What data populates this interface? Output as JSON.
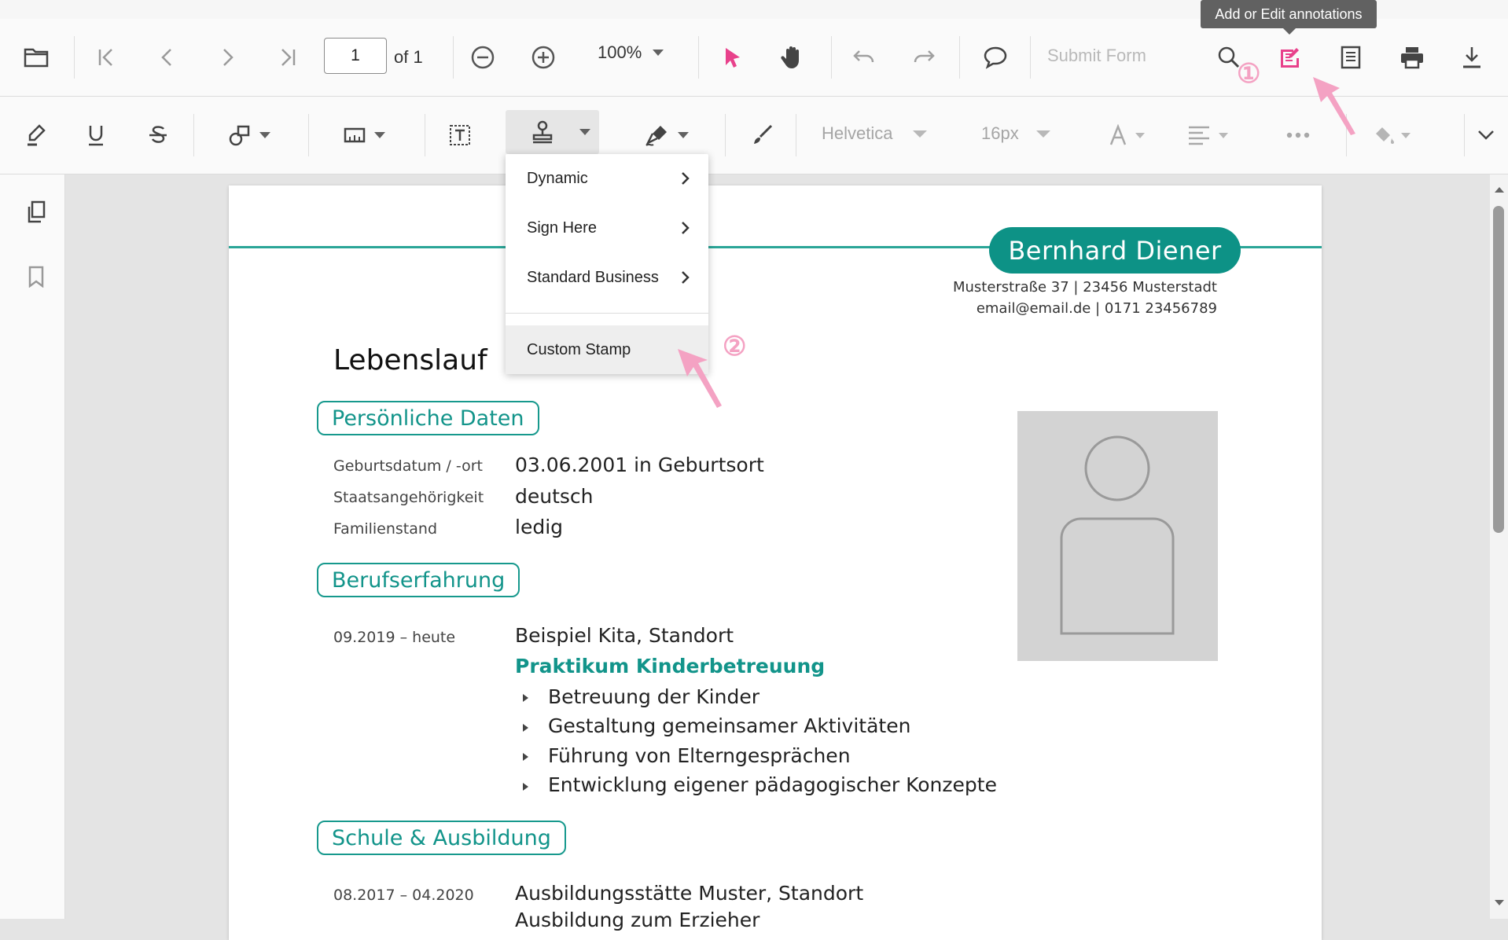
{
  "toolbar": {
    "page_number": "1",
    "page_of": "of 1",
    "zoom": "100%",
    "submit_form": "Submit Form"
  },
  "annotation_toolbar": {
    "font_name": "Helvetica",
    "font_size": "16px"
  },
  "tooltip": "Add or Edit annotations",
  "stamp_menu": {
    "items": [
      "Dynamic",
      "Sign Here",
      "Standard Business"
    ],
    "custom": "Custom Stamp"
  },
  "callouts": {
    "first": "①",
    "second": "②"
  },
  "document": {
    "name": "Bernhard Diener",
    "address_line1": "Musterstraße 37 | 23456 Musterstadt",
    "address_line2": "email@email.de | 0171 23456789",
    "title": "Lebenslauf",
    "section_personal": "Persönliche Daten",
    "personal": [
      {
        "label": "Geburtsdatum / -ort",
        "value": "03.06.2001 in Geburtsort"
      },
      {
        "label": "Staatsangehörigkeit",
        "value": "deutsch"
      },
      {
        "label": "Familienstand",
        "value": "ledig"
      }
    ],
    "section_work": "Berufserfahrung",
    "work_period": "09.2019 – heute",
    "work_place": "Beispiel Kita, Standort",
    "work_role": "Praktikum Kinderbetreuung",
    "work_bullets": [
      "Betreuung der Kinder",
      "Gestaltung gemeinsamer Aktivitäten",
      "Führung von Elterngesprächen",
      "Entwicklung eigener pädagogischer Konzepte"
    ],
    "section_school": "Schule & Ausbildung",
    "school_period": "08.2017 – 04.2020",
    "school_place": "Ausbildungsstätte Muster, Standort",
    "school_role": "Ausbildung zum Erzieher"
  },
  "colors": {
    "accent_teal": "#0d9286",
    "annotation_pink": "#e8418b",
    "pointer_pink": "#f18fb8"
  }
}
